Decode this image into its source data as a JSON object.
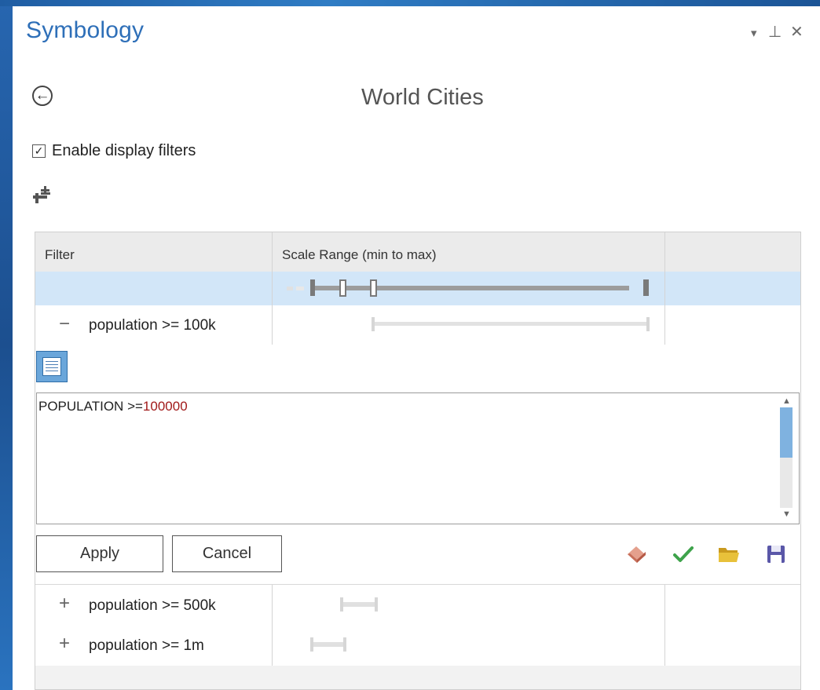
{
  "pane": {
    "title": "Symbology",
    "menu_glyph": "▾",
    "pin_glyph": "⊥",
    "close_glyph": "✕"
  },
  "header": {
    "back_glyph": "←",
    "layer_name": "World Cities"
  },
  "display_filters": {
    "enabled": true,
    "check_glyph": "✓",
    "label": "Enable display filters"
  },
  "grid": {
    "columns": [
      "Filter",
      "Scale Range (min to max)",
      ""
    ],
    "rows": [
      {
        "label": "population >= 100k",
        "expander": "−",
        "expanded": true
      },
      {
        "label": "population >= 500k",
        "expander": "+",
        "expanded": false
      },
      {
        "label": "population >= 1m",
        "expander": "+",
        "expanded": false
      }
    ]
  },
  "editor": {
    "expression_field": "POPULATION",
    "expression_operator": ">=",
    "expression_value": "100000",
    "apply_label": "Apply",
    "cancel_label": "Cancel"
  },
  "icons": {
    "add_filter": "add-filter-icon",
    "mode_toggle": "sql-mode-icon",
    "clear": "eraser-icon",
    "verify": "checkmark-icon",
    "open": "folder-open-icon",
    "save": "save-icon"
  },
  "colors": {
    "title": "#2e6fb8",
    "selected_row": "#d2e6f8",
    "expression_value": "#a11a1a",
    "verify": "#3ea34b",
    "folder": "#e3b72e",
    "save": "#5a57a8"
  }
}
